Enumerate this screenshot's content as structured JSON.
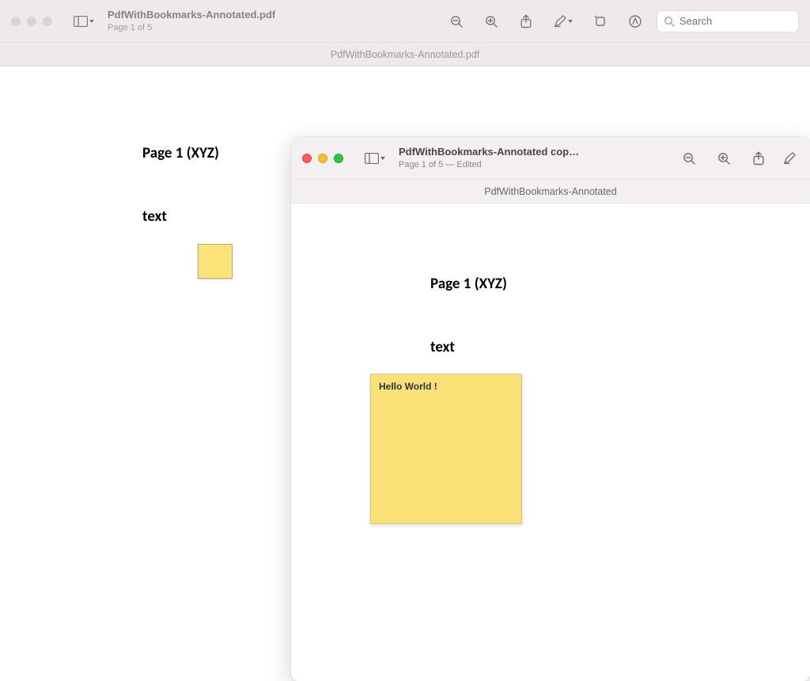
{
  "back": {
    "title": "PdfWithBookmarks-Annotated.pdf",
    "subtitle": "Page 1 of 5",
    "subheader": "PdfWithBookmarks-Annotated.pdf",
    "search_placeholder": "Search",
    "doc": {
      "heading": "Page 1 (XYZ)",
      "text": "text"
    }
  },
  "front": {
    "title": "PdfWithBookmarks-Annotated copy....",
    "subtitle": "Page 1 of 5 — Edited",
    "subheader": "PdfWithBookmarks-Annotated",
    "doc": {
      "heading": "Page 1 (XYZ)",
      "text": "text",
      "note": "Hello World !"
    }
  }
}
